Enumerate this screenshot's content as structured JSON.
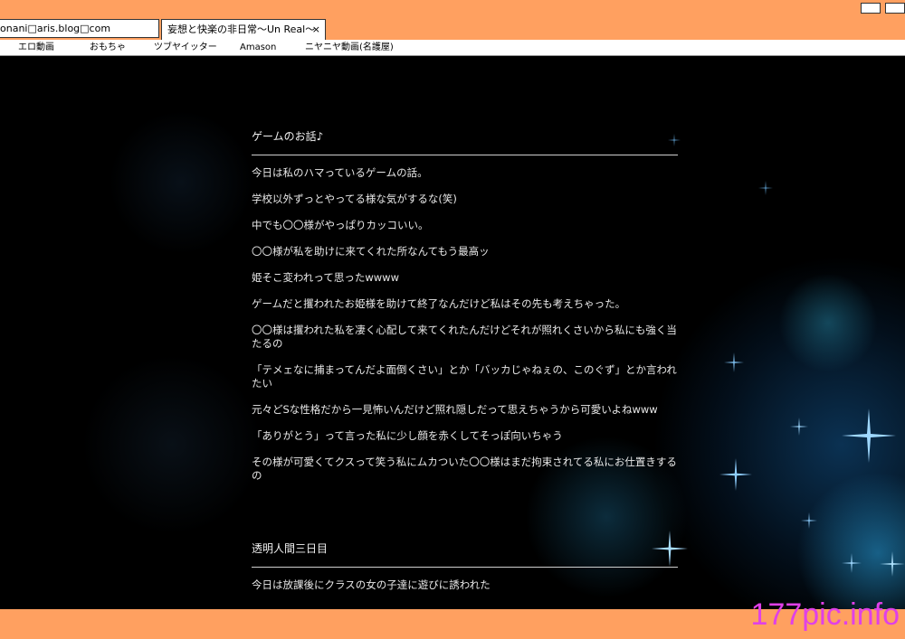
{
  "browser": {
    "address": "onani□aris.blog□com",
    "tab_title": "妄想と快楽の非日常〜Un Real〜",
    "tab_close": "×"
  },
  "bookmarks": [
    {
      "label": "エロ動画"
    },
    {
      "label": "おもちゃ"
    },
    {
      "label": "ツブヤイッター"
    },
    {
      "label": "Amason"
    },
    {
      "label": "ニヤニヤ動画(名護屋)"
    }
  ],
  "articles": [
    {
      "title": "ゲームのお話♪",
      "paragraphs": [
        " 今日は私のハマっているゲームの話。",
        "学校以外ずっとやってる様な気がするな(笑)",
        "中でも〇〇様がやっぱりカッコいい。",
        "〇〇様が私を助けに来てくれた所なんてもう最高ッ",
        "姫そこ変われって思ったwwww",
        "ゲームだと攫われたお姫様を助けて終了なんだけど私はその先も考えちゃった。",
        "〇〇様は攫われた私を凄く心配して来てくれたんだけどそれが照れくさいから私にも強く当たるの",
        "「テメェなに捕まってんだよ面倒くさい」とか「バッカじゃねぇの、このぐず」とか言われたい",
        "元々どSな性格だから一見怖いんだけど照れ隠しだって思えちゃうから可愛いよねwww",
        "「ありがとう」って言った私に少し顔を赤くしてそっぽ向いちゃう",
        "その様が可愛くてクスって笑う私にムカついた〇〇様はまだ拘束されてる私にお仕置きするの"
      ]
    },
    {
      "title": "透明人間三日目",
      "paragraphs": [
        " 今日は放課後にクラスの女の子達に遊びに誘われた"
      ]
    }
  ],
  "watermark": "177pic.info",
  "colors": {
    "chrome": "#ffa060",
    "background": "#000000",
    "text": "#e8e8e8",
    "watermark": "#e040e8"
  }
}
